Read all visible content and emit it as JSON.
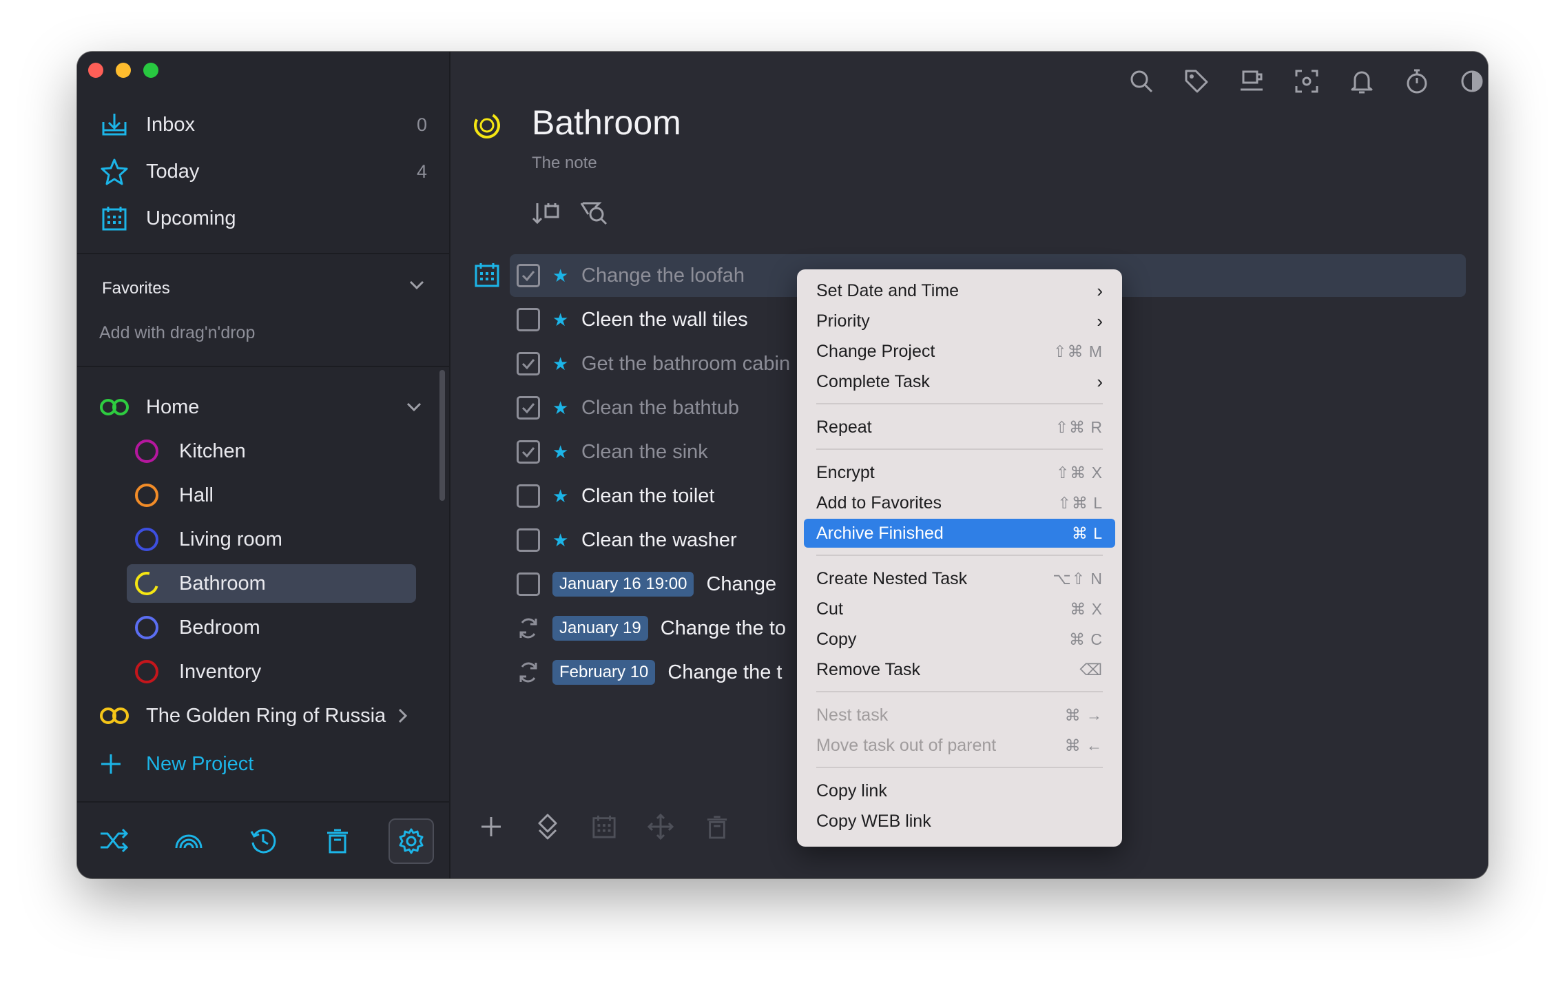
{
  "sidebar": {
    "nav": [
      {
        "label": "Inbox",
        "count": "0"
      },
      {
        "label": "Today",
        "count": "4"
      },
      {
        "label": "Upcoming",
        "count": ""
      }
    ],
    "favorites": {
      "title": "Favorites",
      "hint": "Add with drag'n'drop"
    },
    "projects": {
      "home": {
        "label": "Home"
      },
      "children": [
        {
          "label": "Kitchen",
          "color": "#b5179e"
        },
        {
          "label": "Hall",
          "color": "#f28c28"
        },
        {
          "label": "Living room",
          "color": "#3d4fe0"
        },
        {
          "label": "Bathroom",
          "color": "#f5e613"
        },
        {
          "label": "Bedroom",
          "color": "#5b6ef2"
        },
        {
          "label": "Inventory",
          "color": "#c4161c"
        }
      ],
      "golden": {
        "label": "The Golden Ring of Russia"
      }
    },
    "new_project": "New Project"
  },
  "header": {
    "title": "Bathroom",
    "note": "The note"
  },
  "tasks": [
    {
      "text": "Change the loofah",
      "checked": true,
      "star": true
    },
    {
      "text": "Cleen the wall tiles",
      "checked": false,
      "star": true
    },
    {
      "text": "Get the bathroom cabin",
      "checked": true,
      "star": true
    },
    {
      "text": "Clean the bathtub",
      "checked": true,
      "star": true
    },
    {
      "text": "Clean the sink",
      "checked": true,
      "star": true
    },
    {
      "text": "Clean the toilet",
      "checked": false,
      "star": true
    },
    {
      "text": "Clean the washer",
      "checked": false,
      "star": true
    },
    {
      "date": "January 16 19:00",
      "text": "Change"
    },
    {
      "date": "January 19",
      "text": "Change the to"
    },
    {
      "date": "February 10",
      "text": "Change the t"
    }
  ],
  "context_menu": {
    "set_date": "Set Date and Time",
    "priority": "Priority",
    "change_project": "Change Project",
    "change_project_sc": "⇧⌘ M",
    "complete_task": "Complete Task",
    "repeat": "Repeat",
    "repeat_sc": "⇧⌘ R",
    "encrypt": "Encrypt",
    "encrypt_sc": "⇧⌘ X",
    "add_favorites": "Add to Favorites",
    "add_favorites_sc": "⇧⌘ L",
    "archive_finished": "Archive Finished",
    "archive_finished_sc": "⌘ L",
    "create_nested": "Create Nested Task",
    "create_nested_sc": "⌥⇧ N",
    "cut": "Cut",
    "cut_sc": "⌘ X",
    "copy": "Copy",
    "copy_sc": "⌘ C",
    "remove_task": "Remove Task",
    "remove_task_sc": "⌫",
    "nest_task": "Nest task",
    "nest_task_sc": "⌘ →",
    "move_out": "Move task out of parent",
    "move_out_sc": "⌘ ←",
    "copy_link": "Copy link",
    "copy_web_link": "Copy WEB link"
  },
  "colors": {
    "accent": "#1cb5e8",
    "menu_highlight": "#2f7fe6",
    "home": "#2ecc40",
    "golden": "#f5c518"
  }
}
